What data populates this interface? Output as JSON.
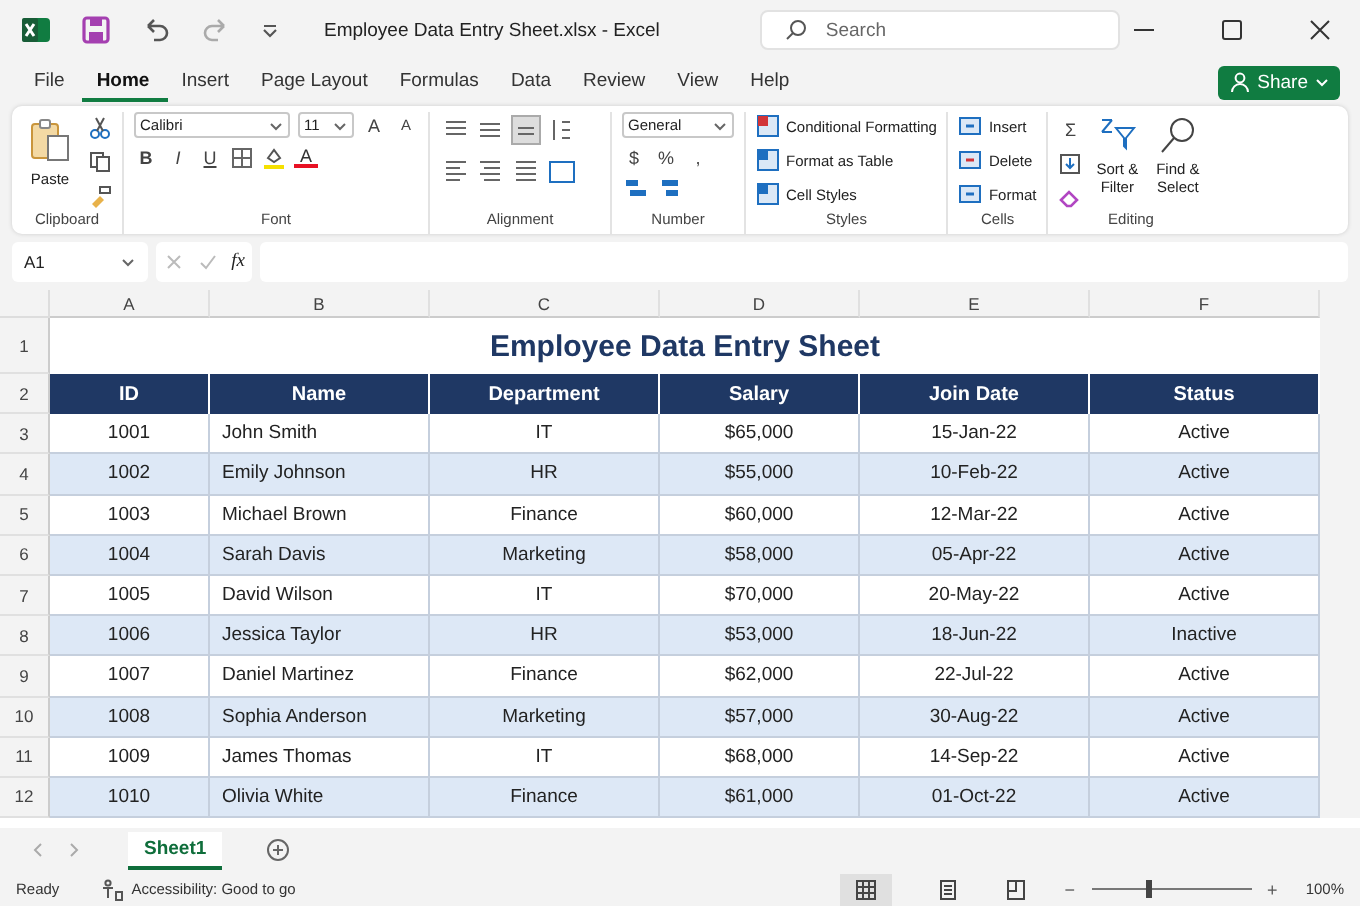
{
  "title_bar": {
    "document_title": "Employee Data Entry Sheet.xlsx",
    "separator": "-",
    "app_name": "Excel",
    "search": {
      "placeholder": "Search"
    }
  },
  "menu_tabs": [
    {
      "label": "File",
      "selected": false
    },
    {
      "label": "Home",
      "selected": true
    },
    {
      "label": "Insert",
      "selected": false
    },
    {
      "label": "Page Layout",
      "selected": false
    },
    {
      "label": "Formulas",
      "selected": false
    },
    {
      "label": "Data",
      "selected": false
    },
    {
      "label": "Review",
      "selected": false
    },
    {
      "label": "View",
      "selected": false
    },
    {
      "label": "Help",
      "selected": false
    }
  ],
  "share_button": "Share",
  "ribbon": {
    "clipboard": {
      "label": "Clipboard",
      "paste": "Paste"
    },
    "font": {
      "label": "Font",
      "font_name": "Calibri",
      "font_size": "11",
      "grow": "A",
      "shrink": "A",
      "bold": "B",
      "italic": "I",
      "underline": "U",
      "font_color": "A"
    },
    "alignment": {
      "label": "Alignment"
    },
    "number": {
      "label": "Number",
      "format": "General",
      "currency": "$",
      "percent": "%",
      "comma": ","
    },
    "styles": {
      "label": "Styles",
      "items": [
        "Conditional Formatting",
        "Format as Table",
        "Cell Styles"
      ]
    },
    "cells": {
      "label": "Cells",
      "items": [
        "Insert",
        "Delete",
        "Format"
      ]
    },
    "editing": {
      "label": "Editing",
      "sum": "Σ",
      "sort": [
        "Sort &",
        "Filter"
      ],
      "find": [
        "Find &",
        "Select"
      ]
    }
  },
  "formula_bar": {
    "name_box": "A1",
    "fx": "fx"
  },
  "sheet": {
    "column_letters": [
      "A",
      "B",
      "C",
      "D",
      "E",
      "F"
    ],
    "title_row": "1",
    "title": "Employee Data Entry Sheet",
    "header_row": "2",
    "headers": [
      "ID",
      "Name",
      "Department",
      "Salary",
      "Join Date",
      "Status"
    ],
    "rows": [
      {
        "number": "3",
        "cells": [
          "1001",
          "John Smith",
          "IT",
          "$65,000",
          "15-Jan-22",
          "Active"
        ]
      },
      {
        "number": "4",
        "cells": [
          "1002",
          "Emily Johnson",
          "HR",
          "$55,000",
          "10-Feb-22",
          "Active"
        ]
      },
      {
        "number": "5",
        "cells": [
          "1003",
          "Michael Brown",
          "Finance",
          "$60,000",
          "12-Mar-22",
          "Active"
        ]
      },
      {
        "number": "6",
        "cells": [
          "1004",
          "Sarah Davis",
          "Marketing",
          "$58,000",
          "05-Apr-22",
          "Active"
        ]
      },
      {
        "number": "7",
        "cells": [
          "1005",
          "David Wilson",
          "IT",
          "$70,000",
          "20-May-22",
          "Active"
        ]
      },
      {
        "number": "8",
        "cells": [
          "1006",
          "Jessica Taylor",
          "HR",
          "$53,000",
          "18-Jun-22",
          "Inactive"
        ]
      },
      {
        "number": "9",
        "cells": [
          "1007",
          "Daniel Martinez",
          "Finance",
          "$62,000",
          "22-Jul-22",
          "Active"
        ]
      },
      {
        "number": "10",
        "cells": [
          "1008",
          "Sophia Anderson",
          "Marketing",
          "$57,000",
          "30-Aug-22",
          "Active"
        ]
      },
      {
        "number": "11",
        "cells": [
          "1009",
          "James Thomas",
          "IT",
          "$68,000",
          "14-Sep-22",
          "Active"
        ]
      },
      {
        "number": "12",
        "cells": [
          "1010",
          "Olivia White",
          "Finance",
          "$61,000",
          "01-Oct-22",
          "Active"
        ]
      }
    ]
  },
  "sheet_tabs": [
    {
      "label": "Sheet1",
      "selected": true
    }
  ],
  "status_bar": {
    "status": "Ready",
    "accessibility": "Accessibility: Good to go",
    "zoom": {
      "minus": "−",
      "level": 0.36,
      "plus": "+",
      "reading": "100%"
    }
  }
}
